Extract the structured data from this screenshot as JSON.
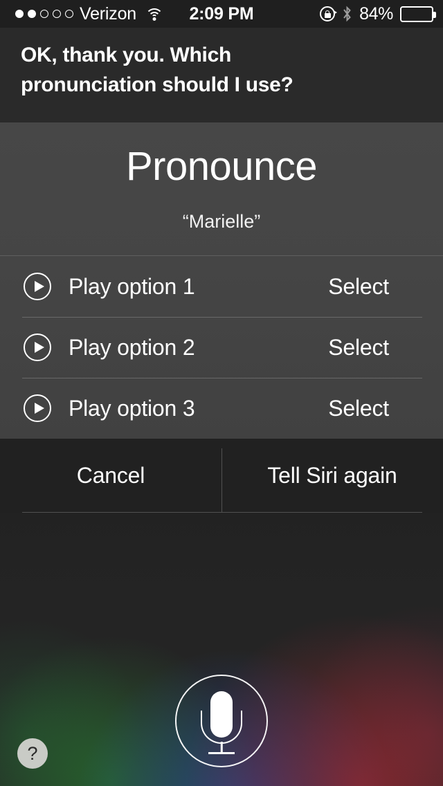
{
  "status_bar": {
    "signal_dots_filled": 2,
    "signal_dots_total": 5,
    "carrier": "Verizon",
    "wifi_icon": "wifi-icon",
    "time": "2:09 PM",
    "rotation_lock_icon": "rotation-lock-icon",
    "bluetooth_icon": "bluetooth-icon",
    "battery_percent": "84%",
    "battery_level": 84
  },
  "siri_reply": {
    "line1": "OK, thank you. Which",
    "line2": "pronunciation should I use?"
  },
  "card": {
    "title": "Pronounce",
    "subtitle": "“Marielle”",
    "options": [
      {
        "play_icon": "play-icon",
        "label": "Play option 1",
        "action": "Select"
      },
      {
        "play_icon": "play-icon",
        "label": "Play option 2",
        "action": "Select"
      },
      {
        "play_icon": "play-icon",
        "label": "Play option 3",
        "action": "Select"
      }
    ]
  },
  "actions": {
    "cancel": "Cancel",
    "retry": "Tell Siri again"
  },
  "mic_button": {
    "icon": "microphone-icon"
  },
  "help_button": {
    "label": "?"
  },
  "colors": {
    "status_bar_bg": "#1f1f1f",
    "reply_bg": "#2a2a2a",
    "card_bg": "#454545",
    "action_bar_bg": "#212121",
    "help_bg": "#c9cbc6",
    "text": "#ffffff"
  }
}
